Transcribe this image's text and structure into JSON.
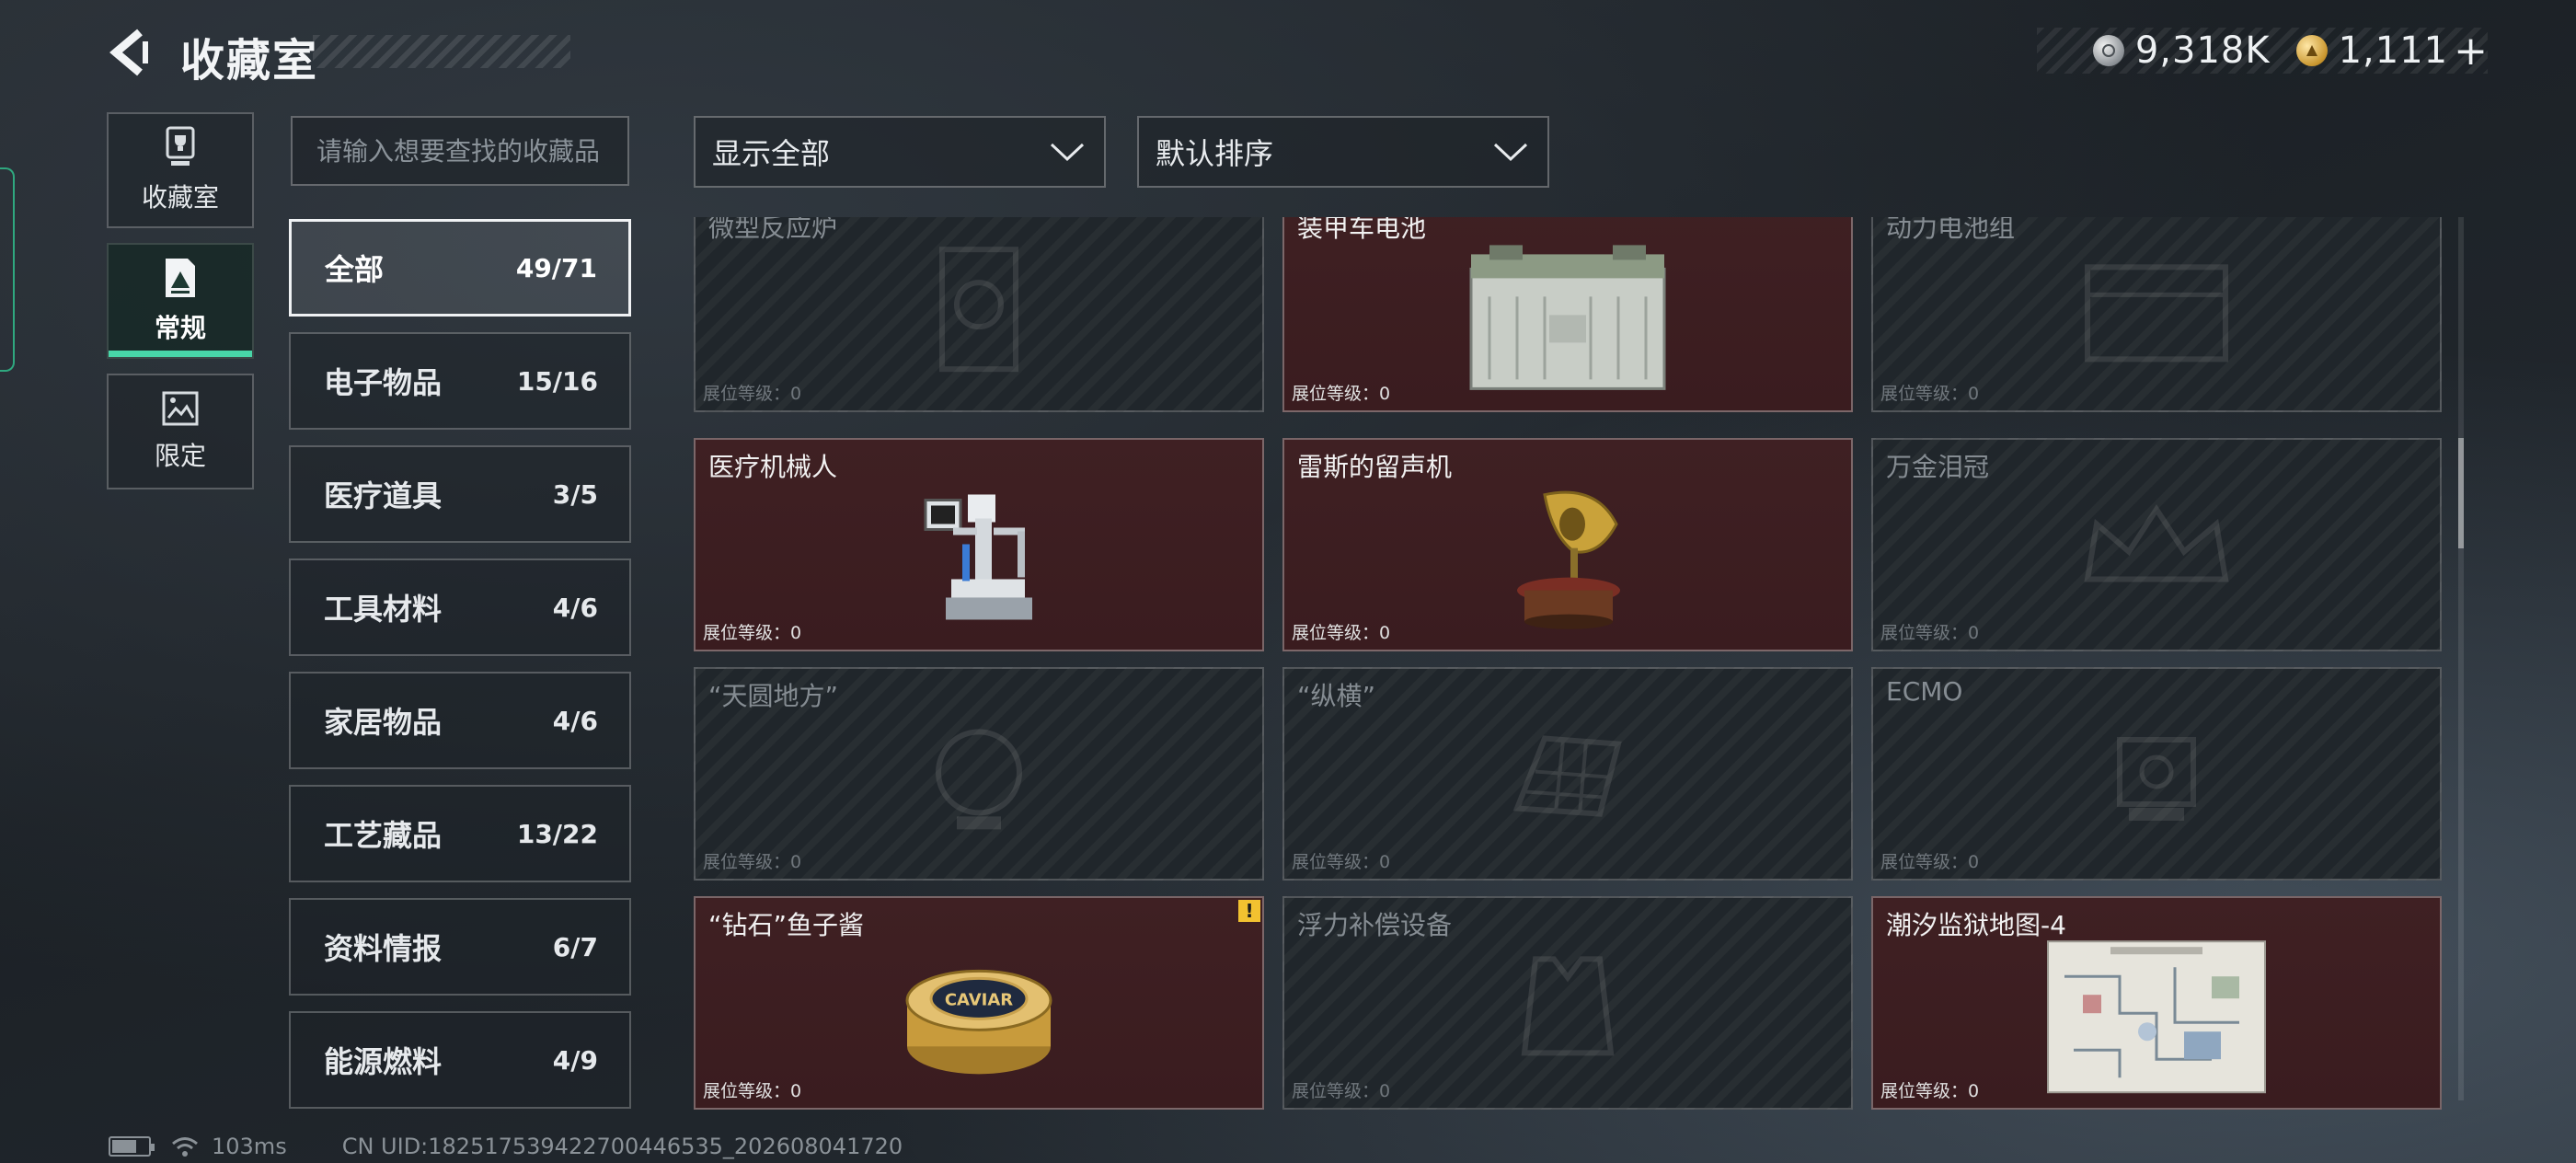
{
  "header": {
    "title": "收藏室",
    "currency": [
      {
        "icon": "silver-coin-icon",
        "value": "9,318K"
      },
      {
        "icon": "gold-coin-icon",
        "value": "1,111"
      }
    ],
    "add_symbol": "+"
  },
  "left_nav": [
    {
      "label": "收藏室",
      "icon": "trophy-icon"
    },
    {
      "label": "常规",
      "icon": "document-mountain-icon",
      "active": true
    },
    {
      "label": "限定",
      "icon": "picture-icon"
    }
  ],
  "search": {
    "placeholder": "请输入想要查找的收藏品",
    "value": ""
  },
  "filters": {
    "show": "显示全部",
    "sort": "默认排序"
  },
  "categories": [
    {
      "name": "全部",
      "count": "49/71",
      "active": true
    },
    {
      "name": "电子物品",
      "count": "15/16"
    },
    {
      "name": "医疗道具",
      "count": "3/5"
    },
    {
      "name": "工具材料",
      "count": "4/6"
    },
    {
      "name": "家居物品",
      "count": "4/6"
    },
    {
      "name": "工艺藏品",
      "count": "13/22"
    },
    {
      "name": "资料情报",
      "count": "6/7"
    },
    {
      "name": "能源燃料",
      "count": "4/9"
    }
  ],
  "level_label": "展位等级：",
  "items": [
    {
      "name": "微型反应炉",
      "level": "0",
      "owned": false,
      "icon": "reactor-icon"
    },
    {
      "name": "装甲车电池",
      "level": "0",
      "owned": true,
      "icon": "battery-icon"
    },
    {
      "name": "动力电池组",
      "level": "0",
      "owned": false,
      "icon": "battery-pack-icon"
    },
    {
      "name": "医疗机械人",
      "level": "0",
      "owned": true,
      "icon": "medical-robot-icon"
    },
    {
      "name": "雷斯的留声机",
      "level": "0",
      "owned": true,
      "icon": "gramophone-icon"
    },
    {
      "name": "万金泪冠",
      "level": "0",
      "owned": false,
      "icon": "crown-icon"
    },
    {
      "name": "“天圆地方”",
      "level": "0",
      "owned": false,
      "icon": "globe-icon"
    },
    {
      "name": "“纵横”",
      "level": "0",
      "owned": false,
      "icon": "chessboard-icon"
    },
    {
      "name": "ECMO",
      "level": "0",
      "owned": false,
      "icon": "ecmo-icon"
    },
    {
      "name": "“钻石”鱼子酱",
      "level": "0",
      "owned": true,
      "icon": "caviar-tin-icon",
      "alert": "!"
    },
    {
      "name": "浮力补偿设备",
      "level": "0",
      "owned": false,
      "icon": "bcd-vest-icon"
    },
    {
      "name": "潮汐监狱地图-4",
      "level": "0",
      "owned": true,
      "icon": "map-icon"
    }
  ],
  "caviar_label": "CAVIAR",
  "status_bar": {
    "ping": "103ms",
    "uid": "CN UID:182517539422700446535_202608041720"
  },
  "colors": {
    "accent": "#48d6a8",
    "owned_bg": "#3d1e21",
    "missing_bg": "#20262b",
    "alert": "#f2c230"
  }
}
